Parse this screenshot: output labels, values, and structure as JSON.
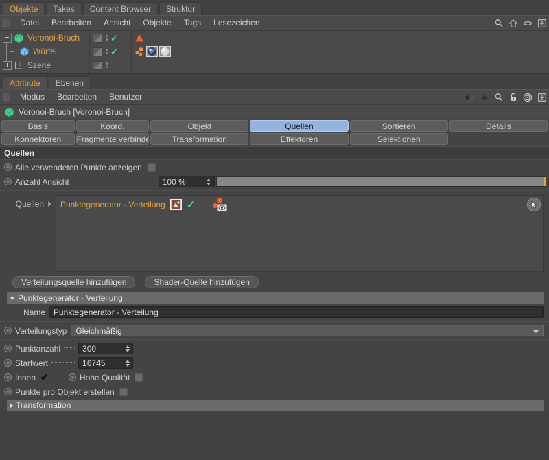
{
  "object_manager": {
    "tabs": [
      {
        "label": "Objekte",
        "active": true
      },
      {
        "label": "Takes",
        "active": false
      },
      {
        "label": "Content Browser",
        "active": false
      },
      {
        "label": "Struktur",
        "active": false
      }
    ],
    "menus": [
      "Datei",
      "Bearbeiten",
      "Ansicht",
      "Objekte",
      "Tags",
      "Lesezeichen"
    ],
    "toolbar_icons": [
      "search-icon",
      "home-icon",
      "ellipse-icon",
      "plus-box-icon"
    ],
    "tree": [
      {
        "label": "Voronoi-Bruch",
        "color": "orange",
        "icon": "voronoi-fracture-icon",
        "toggle": "minus",
        "depth": 0,
        "check": true,
        "tags": [
          "orange-triangle-tag"
        ]
      },
      {
        "label": "Würfel",
        "color": "orange",
        "icon": "cube-icon",
        "toggle": "none",
        "depth": 1,
        "check": true,
        "tags": [
          "point-generator-tag",
          "material-blue-tag",
          "material-white-tag"
        ]
      },
      {
        "label": "Szene",
        "color": "grey",
        "icon": "layer-zero-icon",
        "toggle": "plus",
        "depth": 0,
        "check": false,
        "tags": []
      }
    ]
  },
  "attribute_manager": {
    "tabs": [
      {
        "label": "Attribute",
        "active": true
      },
      {
        "label": "Ebenen",
        "active": false
      }
    ],
    "menus": [
      "Modus",
      "Bearbeiten",
      "Benutzer"
    ],
    "toolbar_icons": [
      "back-arrow-icon",
      "forward-arrow-icon",
      "up-arrow-icon",
      "search-icon",
      "lock-icon",
      "target-icon",
      "plus-box-icon"
    ],
    "object_header": {
      "icon": "voronoi-fracture-icon",
      "title": "Voronoi-Bruch [Voronoi-Bruch]"
    },
    "param_tabs_row1": [
      {
        "label": "Basis",
        "selected": false
      },
      {
        "label": "Koord.",
        "selected": false
      },
      {
        "label": "Objekt",
        "selected": false
      },
      {
        "label": "Quellen",
        "selected": true
      },
      {
        "label": "Sortieren",
        "selected": false
      },
      {
        "label": "Details",
        "selected": false
      }
    ],
    "param_tabs_row2": [
      {
        "label": "Konnektoren",
        "selected": false
      },
      {
        "label": "Fragmente verbinden",
        "selected": false
      },
      {
        "label": "Transformation",
        "selected": false
      },
      {
        "label": "Effektoren",
        "selected": false
      },
      {
        "label": "Selektionen",
        "selected": false
      }
    ]
  },
  "quellen": {
    "group_title": "Quellen",
    "show_all_points": {
      "label": "Alle verwendeten Punkte anzeigen",
      "checked": false
    },
    "view_count": {
      "label": "Anzahl Ansicht",
      "value": "100 %",
      "slider_percent": 100
    },
    "list_label": "Quellen",
    "list_items": [
      {
        "name": "Punktegenerator - Verteilung",
        "icon": "shader-source-icon",
        "enabled": true,
        "viewport_icon": "point-generator-eye-icon"
      }
    ],
    "list_corner_icon": "cursor-arrow-icon",
    "buttons": [
      {
        "label": "Verteilungsquelle hinzufügen"
      },
      {
        "label": "Shader-Quelle hinzufügen"
      }
    ]
  },
  "point_generator": {
    "group_title": "Punktegenerator - Verteilung",
    "group_expanded": true,
    "name": {
      "label": "Name",
      "value": "Punktegenerator - Verteilung"
    },
    "distribution_type": {
      "label": "Verteilungstyp",
      "value": "Gleichmäßig"
    },
    "point_count": {
      "label": "Punktanzahl",
      "value": "300"
    },
    "seed": {
      "label": "Startwert",
      "value": "16745"
    },
    "inside": {
      "label": "Innen",
      "checked": true
    },
    "high_quality": {
      "label": "Hohe Qualität",
      "checked": false
    },
    "points_per_object": {
      "label": "Punkte pro Objekt erstellen",
      "checked": false
    },
    "transformation": {
      "label": "Transformation",
      "expanded": false
    }
  },
  "colors": {
    "accent_orange": "#e8a33d",
    "selected_tab_blue": "#93b3e0",
    "check_green": "#3fd39a",
    "panel_bg": "#444444",
    "window_bg": "#414141"
  }
}
